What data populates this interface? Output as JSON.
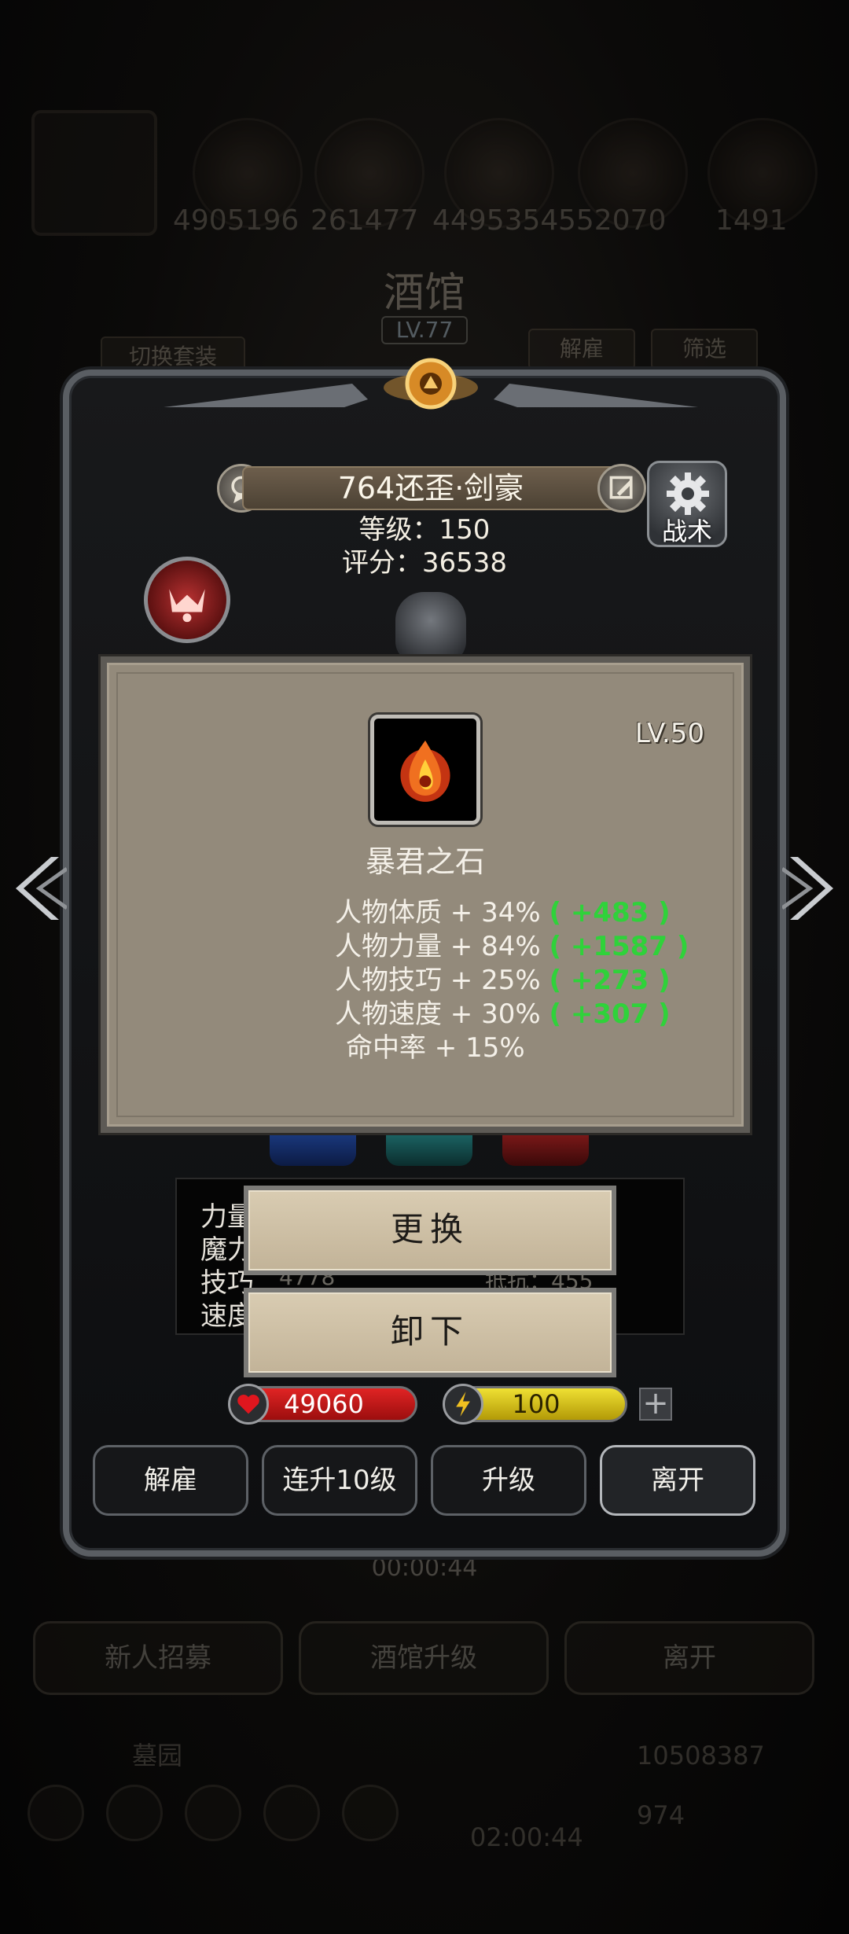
{
  "background": {
    "resources": [
      "4905196",
      "261477",
      "4495354",
      "552070",
      "1491"
    ],
    "title": "酒馆",
    "level": "LV.77",
    "switch_outfit": "切换套装",
    "dismiss": "解雇",
    "filter": "筛选",
    "timer": "00:00:44",
    "buttons": [
      "新人招募",
      "酒馆升级",
      "离开"
    ],
    "cemetery": "墓园",
    "bottom_timer": "02:00:44",
    "gold": "10508387",
    "gems": "974"
  },
  "hero": {
    "name": "764还歪·剑豪",
    "level_line": "等级：150",
    "score_line": "评分：36538",
    "tactics_label": "战术"
  },
  "stats_box": {
    "rows": [
      "力量",
      "魔力",
      "技巧",
      "速度"
    ],
    "partial_value": "4778",
    "partial_extra": "抵抗：455"
  },
  "tooltip": {
    "level": "LV.50",
    "item_name": "暴君之石",
    "stats": [
      {
        "text": "人物体质 + 34%",
        "bonus": "( +483 )"
      },
      {
        "text": "人物力量 + 84%",
        "bonus": "( +1587 )"
      },
      {
        "text": "人物技巧 + 25%",
        "bonus": "( +273 )"
      },
      {
        "text": "人物速度 + 30%",
        "bonus": "( +307 )"
      },
      {
        "text": "命中率 + 15%",
        "bonus": ""
      }
    ]
  },
  "actions": {
    "replace": "更换",
    "unequip": "卸下"
  },
  "currency": {
    "hp": "49060",
    "energy": "100",
    "plus": "+"
  },
  "panel_buttons": [
    "解雇",
    "连升10级",
    "升级",
    "离开"
  ],
  "colors": {
    "bonus_green": "#2fd23a",
    "hp_red": "#d01818",
    "energy_yellow": "#e0d01a",
    "tooltip_bg": "#938a7b"
  }
}
